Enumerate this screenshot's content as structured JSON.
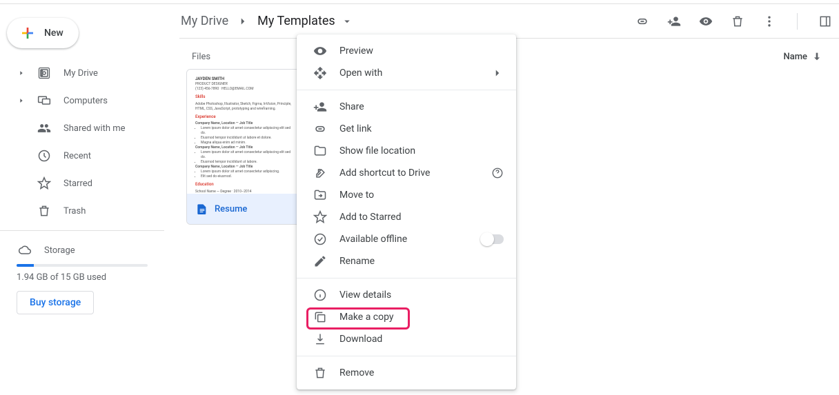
{
  "sidebar": {
    "new_label": "New",
    "items": [
      {
        "label": "My Drive",
        "icon": "drive",
        "expandable": true
      },
      {
        "label": "Computers",
        "icon": "computers",
        "expandable": true
      },
      {
        "label": "Shared with me",
        "icon": "shared",
        "expandable": false
      },
      {
        "label": "Recent",
        "icon": "recent",
        "expandable": false
      },
      {
        "label": "Starred",
        "icon": "star",
        "expandable": false
      },
      {
        "label": "Trash",
        "icon": "trash",
        "expandable": false
      }
    ],
    "storage": {
      "label": "Storage",
      "used_text": "1.94 GB of 15 GB used",
      "buy_label": "Buy storage"
    }
  },
  "breadcrumb": {
    "root": "My Drive",
    "current": "My Templates"
  },
  "content": {
    "section_label": "Files",
    "sort_label": "Name",
    "file": {
      "name": "Resume",
      "thumb_sections": [
        "Skills",
        "Experience",
        "Education"
      ]
    }
  },
  "context_menu": {
    "items": [
      {
        "label": "Preview",
        "icon": "eye"
      },
      {
        "label": "Open with",
        "icon": "openwith",
        "submenu": true
      },
      {
        "sep": true
      },
      {
        "label": "Share",
        "icon": "person-add"
      },
      {
        "label": "Get link",
        "icon": "link"
      },
      {
        "label": "Show file location",
        "icon": "folder"
      },
      {
        "label": "Add shortcut to Drive",
        "icon": "shortcut",
        "help": true
      },
      {
        "label": "Move to",
        "icon": "move"
      },
      {
        "label": "Add to Starred",
        "icon": "star"
      },
      {
        "label": "Available offline",
        "icon": "offline",
        "toggle": true
      },
      {
        "label": "Rename",
        "icon": "rename"
      },
      {
        "sep": true
      },
      {
        "label": "View details",
        "icon": "info"
      },
      {
        "label": "Make a copy",
        "icon": "copy",
        "highlighted": true
      },
      {
        "label": "Download",
        "icon": "download"
      },
      {
        "sep": true
      },
      {
        "label": "Remove",
        "icon": "trash"
      }
    ]
  }
}
